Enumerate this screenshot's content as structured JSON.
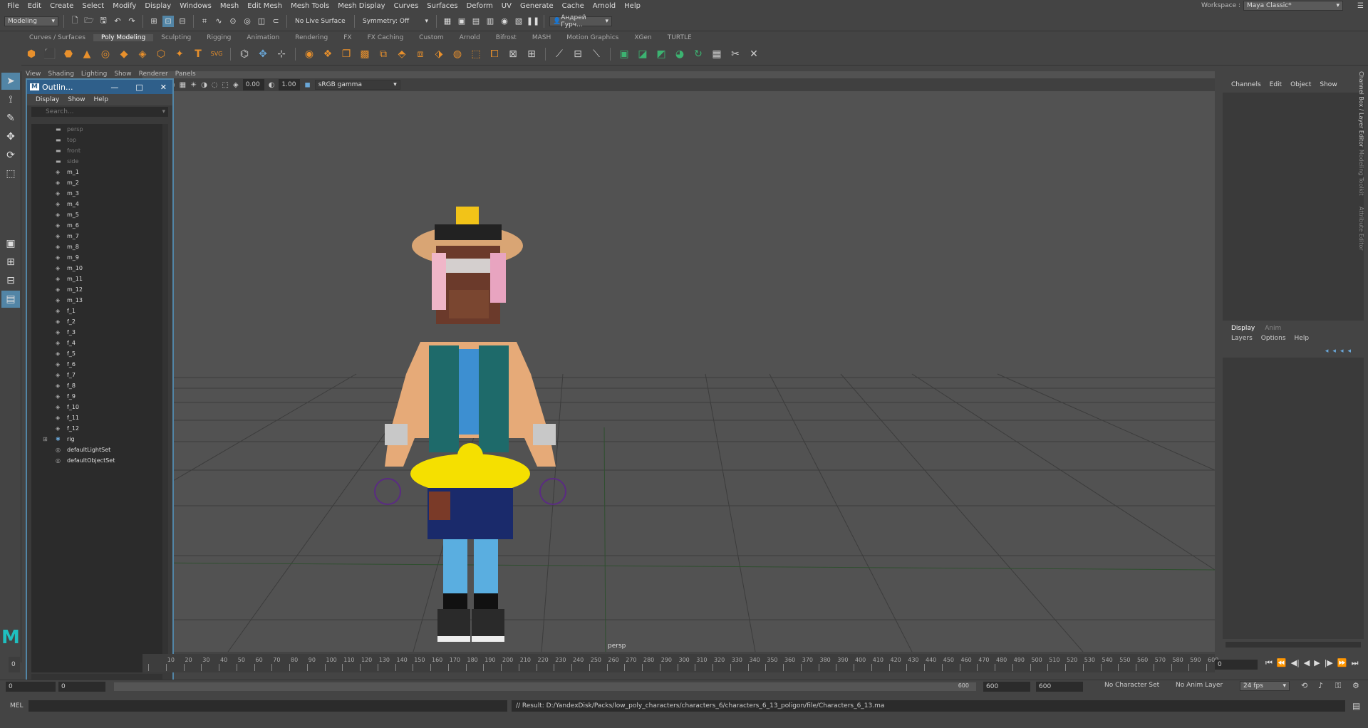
{
  "menus": [
    "File",
    "Edit",
    "Create",
    "Select",
    "Modify",
    "Display",
    "Windows",
    "Mesh",
    "Edit Mesh",
    "Mesh Tools",
    "Mesh Display",
    "Curves",
    "Surfaces",
    "Deform",
    "UV",
    "Generate",
    "Cache",
    "Arnold",
    "Help"
  ],
  "workspace": {
    "label": "Workspace :",
    "value": "Maya Classic*"
  },
  "status": {
    "mode": "Modeling",
    "live_surface": "No Live Surface",
    "symmetry": "Symmetry: Off",
    "user": "Андрей Гурч..."
  },
  "shelf_tabs": [
    "Curves / Surfaces",
    "Poly Modeling",
    "Sculpting",
    "Rigging",
    "Animation",
    "Rendering",
    "FX",
    "FX Caching",
    "Custom",
    "Arnold",
    "Bifrost",
    "MASH",
    "Motion Graphics",
    "XGen",
    "TURTLE"
  ],
  "active_shelf_tab": "Poly Modeling",
  "viewport_menu": [
    "View",
    "Shading",
    "Lighting",
    "Show",
    "Renderer",
    "Panels"
  ],
  "viewport_bar": {
    "exposure": "0.00",
    "gamma": "1.00",
    "colorspace": "sRGB gamma"
  },
  "viewport_camera_label": "persp",
  "outliner": {
    "title": "Outlin...",
    "menu": [
      "Display",
      "Show",
      "Help"
    ],
    "search_placeholder": "Search...",
    "items": [
      {
        "label": "persp",
        "kind": "cam",
        "dim": true
      },
      {
        "label": "top",
        "kind": "cam",
        "dim": true
      },
      {
        "label": "front",
        "kind": "cam",
        "dim": true
      },
      {
        "label": "side",
        "kind": "cam",
        "dim": true
      },
      {
        "label": "m_1",
        "kind": "mesh"
      },
      {
        "label": "m_2",
        "kind": "mesh"
      },
      {
        "label": "m_3",
        "kind": "mesh"
      },
      {
        "label": "m_4",
        "kind": "mesh"
      },
      {
        "label": "m_5",
        "kind": "mesh"
      },
      {
        "label": "m_6",
        "kind": "mesh"
      },
      {
        "label": "m_7",
        "kind": "mesh"
      },
      {
        "label": "m_8",
        "kind": "mesh"
      },
      {
        "label": "m_9",
        "kind": "mesh"
      },
      {
        "label": "m_10",
        "kind": "mesh"
      },
      {
        "label": "m_11",
        "kind": "mesh"
      },
      {
        "label": "m_12",
        "kind": "mesh"
      },
      {
        "label": "m_13",
        "kind": "mesh"
      },
      {
        "label": "f_1",
        "kind": "mesh"
      },
      {
        "label": "f_2",
        "kind": "mesh"
      },
      {
        "label": "f_3",
        "kind": "mesh"
      },
      {
        "label": "f_4",
        "kind": "mesh"
      },
      {
        "label": "f_5",
        "kind": "mesh"
      },
      {
        "label": "f_6",
        "kind": "mesh"
      },
      {
        "label": "f_7",
        "kind": "mesh"
      },
      {
        "label": "f_8",
        "kind": "mesh"
      },
      {
        "label": "f_9",
        "kind": "mesh"
      },
      {
        "label": "f_10",
        "kind": "mesh"
      },
      {
        "label": "f_11",
        "kind": "mesh"
      },
      {
        "label": "f_12",
        "kind": "mesh"
      },
      {
        "label": "rig",
        "kind": "joint",
        "expand": true
      },
      {
        "label": "defaultLightSet",
        "kind": "set"
      },
      {
        "label": "defaultObjectSet",
        "kind": "set"
      }
    ]
  },
  "channel_box": {
    "menu": [
      "Channels",
      "Edit",
      "Object",
      "Show"
    ]
  },
  "layer_editor": {
    "tabs": [
      "Display",
      "Anim"
    ],
    "menu": [
      "Layers",
      "Options",
      "Help"
    ]
  },
  "side_tabs": [
    "Channel Box / Layer Editor",
    "Modeling Toolkit",
    "Attribute Editor"
  ],
  "timeline": {
    "ticks": [
      "0",
      "10",
      "20",
      "30",
      "40",
      "50",
      "60",
      "70",
      "80",
      "90",
      "100",
      "110",
      "120",
      "130",
      "140",
      "150",
      "160",
      "170",
      "180",
      "190",
      "200",
      "210",
      "220",
      "230",
      "240",
      "250",
      "260",
      "270",
      "280",
      "290",
      "300",
      "310",
      "320",
      "330",
      "340",
      "350",
      "360",
      "370",
      "380",
      "390",
      "400",
      "410",
      "420",
      "430",
      "440",
      "450",
      "460",
      "470",
      "480",
      "490",
      "500",
      "510",
      "520",
      "530",
      "540",
      "550",
      "560",
      "570",
      "580",
      "590",
      "600"
    ],
    "current": "0",
    "right_field": "0"
  },
  "range": {
    "start": "0",
    "start2": "0",
    "end_inner": "600",
    "end1": "600",
    "end2": "600",
    "character_set": "No Character Set",
    "anim_layer": "No Anim Layer",
    "fps": "24 fps"
  },
  "cmd": {
    "lang": "MEL",
    "result": "// Result: D:/YandexDisk/Packs/low_poly_characters/characters_6/characters_6_13_poligon/file/Characters_6_13.ma"
  }
}
